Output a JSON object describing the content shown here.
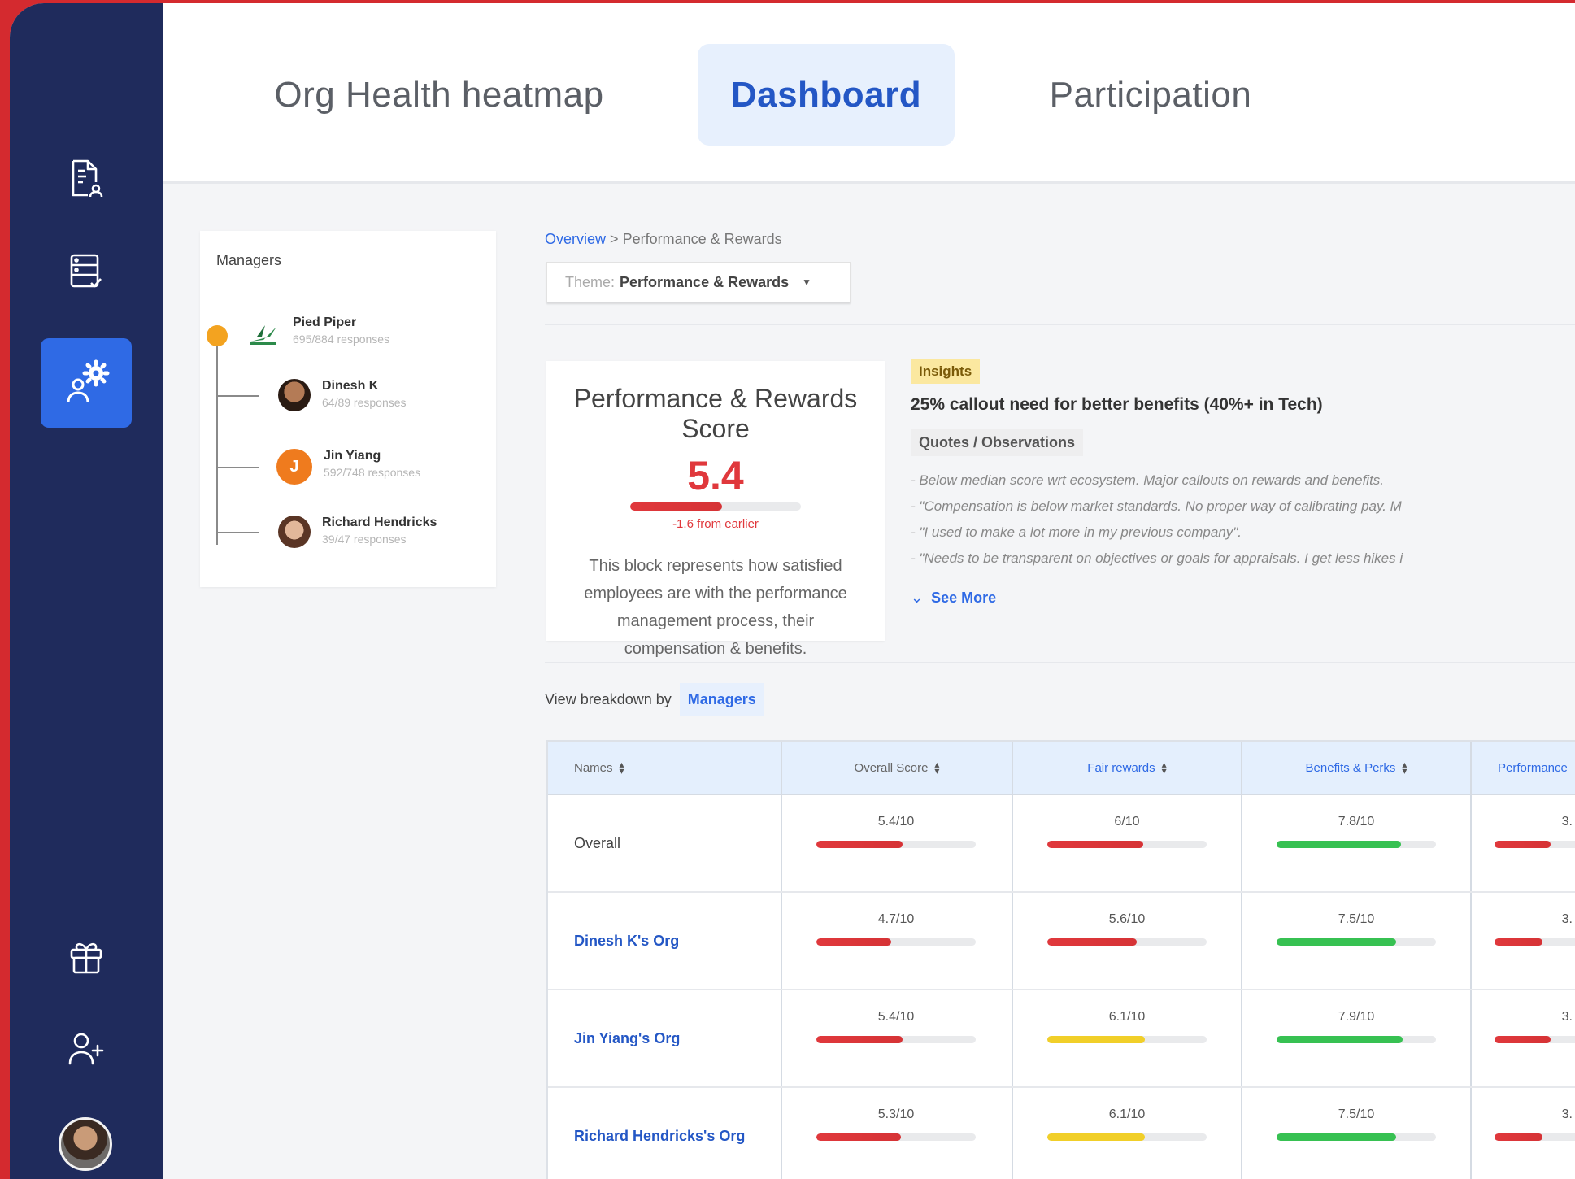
{
  "tabs": [
    {
      "label": "Org Health heatmap",
      "active": false
    },
    {
      "label": "Dashboard",
      "active": true
    },
    {
      "label": "Participation",
      "active": false
    }
  ],
  "sidebar": {
    "icons": [
      "document-user-icon",
      "checklist-icon",
      "user-settings-icon",
      "gift-icon",
      "add-user-icon",
      "avatar"
    ],
    "active": "user-settings-icon"
  },
  "managers": {
    "title": "Managers",
    "root": {
      "name": "Pied Piper",
      "responses": "695/884 responses"
    },
    "children": [
      {
        "name": "Dinesh K",
        "responses": "64/89 responses"
      },
      {
        "name": "Jin Yiang",
        "initial": "J",
        "responses": "592/748 responses"
      },
      {
        "name": "Richard Hendricks",
        "responses": "39/47 responses"
      }
    ]
  },
  "breadcrumb": {
    "root": "Overview",
    "sep": ">",
    "current": "Performance & Rewards"
  },
  "theme": {
    "label": "Theme:",
    "value": "Performance & Rewards"
  },
  "score_card": {
    "title": "Performance & Rewards Score",
    "score": "5.4",
    "score_fraction": 0.54,
    "delta": "-1.6 from earlier",
    "description": "This block represents how satisfied employees are with the performance management process, their compensation & benefits."
  },
  "insights": {
    "badge": "Insights",
    "headline": "25% callout need for better benefits (40%+ in Tech)",
    "quotes_label": "Quotes / Observations",
    "quotes": [
      "- Below median score wrt ecosystem. Major callouts on rewards and benefits.",
      "- \"Compensation is below market standards. No proper way of calibrating pay. M",
      "- \"I used to make a lot more in my previous company\".",
      "- \"Needs to be transparent on objectives or goals for appraisals. I get less hikes i"
    ],
    "see_more": "See More"
  },
  "breakdown": {
    "label": "View breakdown by",
    "value": "Managers"
  },
  "table": {
    "headers": [
      "Names",
      "Overall Score",
      "Fair rewards",
      "Benefits & Perks",
      "Performance"
    ],
    "rows": [
      {
        "name": "Overall",
        "link": false,
        "cells": [
          {
            "text": "5.4/10",
            "fraction": 0.54,
            "color": "red"
          },
          {
            "text": "6/10",
            "fraction": 0.6,
            "color": "red"
          },
          {
            "text": "7.8/10",
            "fraction": 0.78,
            "color": "green"
          },
          {
            "text": "3.",
            "fraction": 0.35,
            "color": "red"
          }
        ]
      },
      {
        "name": "Dinesh K's Org",
        "link": true,
        "cells": [
          {
            "text": "4.7/10",
            "fraction": 0.47,
            "color": "red"
          },
          {
            "text": "5.6/10",
            "fraction": 0.56,
            "color": "red"
          },
          {
            "text": "7.5/10",
            "fraction": 0.75,
            "color": "green"
          },
          {
            "text": "3.",
            "fraction": 0.3,
            "color": "red"
          }
        ]
      },
      {
        "name": "Jin Yiang's Org",
        "link": true,
        "cells": [
          {
            "text": "5.4/10",
            "fraction": 0.54,
            "color": "red"
          },
          {
            "text": "6.1/10",
            "fraction": 0.61,
            "color": "yellow"
          },
          {
            "text": "7.9/10",
            "fraction": 0.79,
            "color": "green"
          },
          {
            "text": "3.",
            "fraction": 0.35,
            "color": "red"
          }
        ]
      },
      {
        "name": "Richard Hendricks's Org",
        "link": true,
        "cells": [
          {
            "text": "5.3/10",
            "fraction": 0.53,
            "color": "red"
          },
          {
            "text": "6.1/10",
            "fraction": 0.61,
            "color": "yellow"
          },
          {
            "text": "7.5/10",
            "fraction": 0.75,
            "color": "green"
          },
          {
            "text": "3.",
            "fraction": 0.3,
            "color": "red"
          }
        ]
      }
    ]
  },
  "colors": {
    "accent": "#2f6ae5",
    "sidebar": "#1f2b5c",
    "danger": "#e0383c",
    "success": "#37c152",
    "warning": "#f1cf29"
  }
}
